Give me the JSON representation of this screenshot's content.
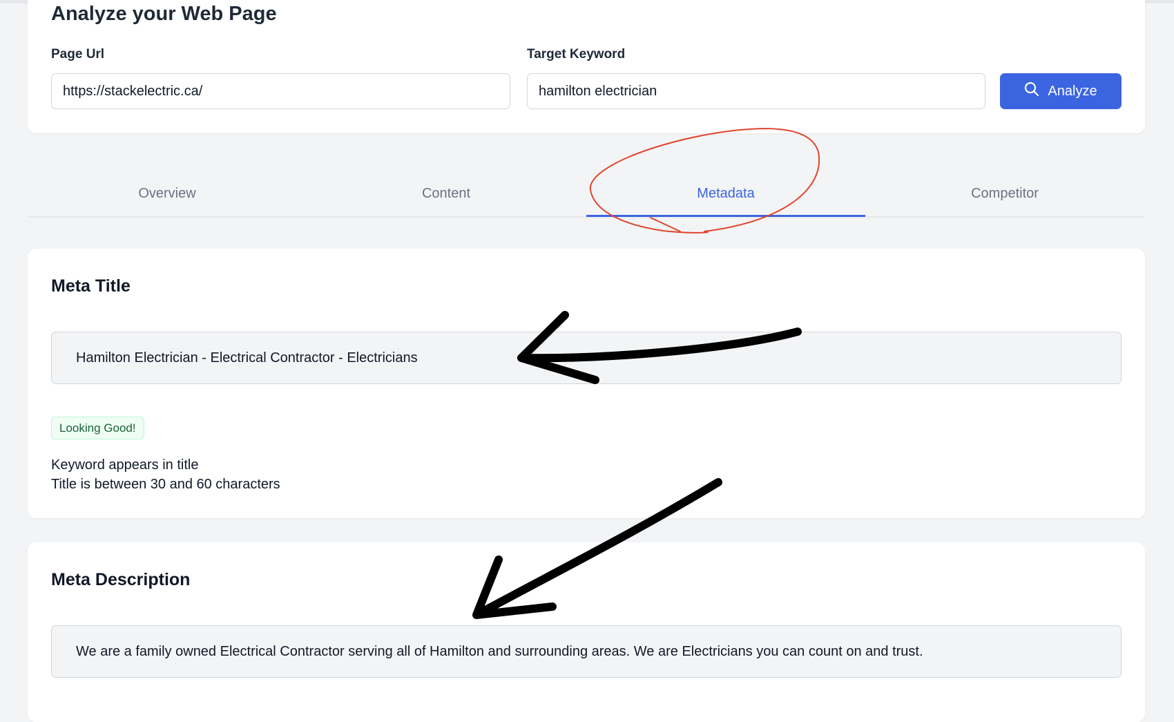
{
  "analyze": {
    "title": "Analyze your Web Page",
    "page_url_label": "Page Url",
    "page_url_value": "https://stackelectric.ca/",
    "keyword_label": "Target Keyword",
    "keyword_value": "hamilton electrician",
    "button_label": "Analyze",
    "button_icon": "search-icon",
    "accent_color": "#3b64e0"
  },
  "tabs": [
    {
      "label": "Overview",
      "active": false
    },
    {
      "label": "Content",
      "active": false
    },
    {
      "label": "Metadata",
      "active": true
    },
    {
      "label": "Competitor",
      "active": false
    }
  ],
  "meta_title": {
    "heading": "Meta Title",
    "value": "Hamilton Electrician - Electrical Contractor - Electricians",
    "status_badge": "Looking Good!",
    "checks": [
      "Keyword appears in title",
      "Title is between 30 and 60 characters"
    ]
  },
  "meta_description": {
    "heading": "Meta Description",
    "value": "We are a family owned Electrical Contractor serving all of Hamilton and surrounding areas. We are Electricians you can count on and trust."
  },
  "annotations": {
    "circle_color": "#e0442b",
    "arrow_color": "#000000"
  }
}
